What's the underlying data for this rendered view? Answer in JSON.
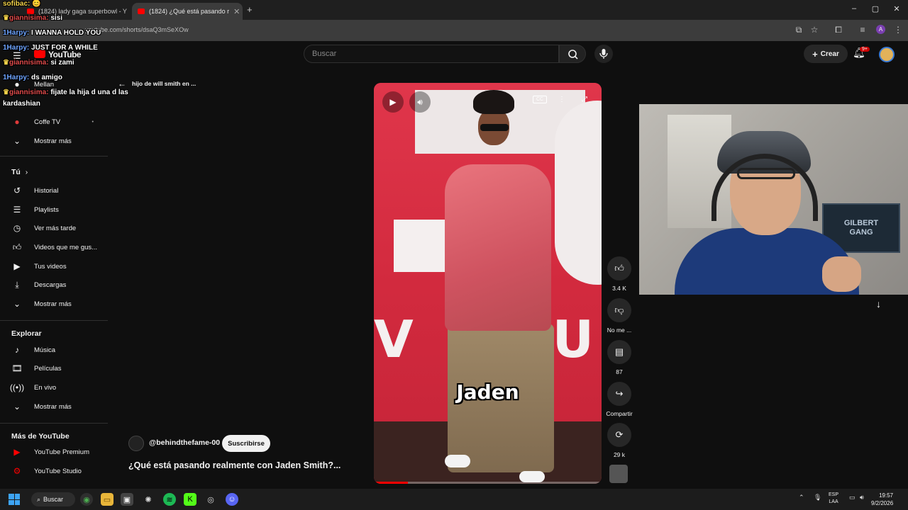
{
  "browser": {
    "tabs": [
      {
        "title": "(1824) lady gaga superbowl - Y"
      },
      {
        "title": "(1824) ¿Qué está pasando r"
      }
    ],
    "new_tab": "+",
    "url": "youtube.com/shorts/dsaQ3mSeXOw"
  },
  "header": {
    "logo": "YouTube",
    "search_placeholder": "Buscar",
    "create_label": "Crear",
    "notifications_badge": "9+"
  },
  "chat": [
    {
      "user": "sofibac:",
      "msg": "😊",
      "color": "gold"
    },
    {
      "user": "giannisima:",
      "msg": "sisi",
      "color": "red"
    },
    {
      "user": "1Harpy:",
      "msg": "I WANNA HOLD YOU",
      "color": "blue"
    },
    {
      "user": "1Harpy:",
      "msg": "JUST FOR A WHILE",
      "color": "blue"
    },
    {
      "user": "giannisima:",
      "msg": "si zami",
      "color": "red"
    },
    {
      "user": "1Harpy:",
      "msg": "ds amigo",
      "color": "blue"
    },
    {
      "user": "giannisima:",
      "msg": "fijate la hija d una d las",
      "color": "red"
    },
    {
      "user": "",
      "msg": "kardashian",
      "color": "white"
    }
  ],
  "sidebar": {
    "subs_partial": [
      "Mellan",
      "Coffe TV"
    ],
    "subs_show_more": "Mostrar más",
    "you_heading": "Tú",
    "you_items": [
      {
        "label": "Historial",
        "icon": "history-icon"
      },
      {
        "label": "Playlists",
        "icon": "playlists-icon"
      },
      {
        "label": "Ver más tarde",
        "icon": "watch-later-icon"
      },
      {
        "label": "Videos que me gus...",
        "icon": "liked-icon"
      },
      {
        "label": "Tus videos",
        "icon": "your-videos-icon"
      },
      {
        "label": "Descargas",
        "icon": "downloads-icon"
      },
      {
        "label": "Mostrar más",
        "icon": "chevron-down-icon"
      }
    ],
    "explore_heading": "Explorar",
    "explore_items": [
      {
        "label": "Música",
        "icon": "music-icon"
      },
      {
        "label": "Películas",
        "icon": "movies-icon"
      },
      {
        "label": "En vivo",
        "icon": "live-icon"
      },
      {
        "label": "Mostrar más",
        "icon": "chevron-down-icon"
      }
    ],
    "more_heading": "Más de YouTube",
    "more_items": [
      {
        "label": "YouTube Premium",
        "icon": "youtube-premium-icon"
      },
      {
        "label": "YouTube Studio",
        "icon": "youtube-studio-icon"
      }
    ]
  },
  "short": {
    "back_label": "hijo de will smith en ...",
    "caption": "Jaden",
    "progress_fraction": 0.15,
    "channel": "@behindthefame-00",
    "subscribe_label": "Suscribirse",
    "title": "¿Qué está pasando realmente con Jaden Smith?..."
  },
  "actions": {
    "likes": "3.4 K",
    "dislike_label": "No me ...",
    "comments": "87",
    "share_label": "Compartir",
    "remix": "29 k"
  },
  "webcam": {
    "logo_text": "GILBERT\nGANG"
  },
  "taskbar": {
    "search_label": "Buscar",
    "lang_top": "ESP",
    "lang_bottom": "LAA",
    "time": "19:57",
    "date": "9/2/2026"
  }
}
